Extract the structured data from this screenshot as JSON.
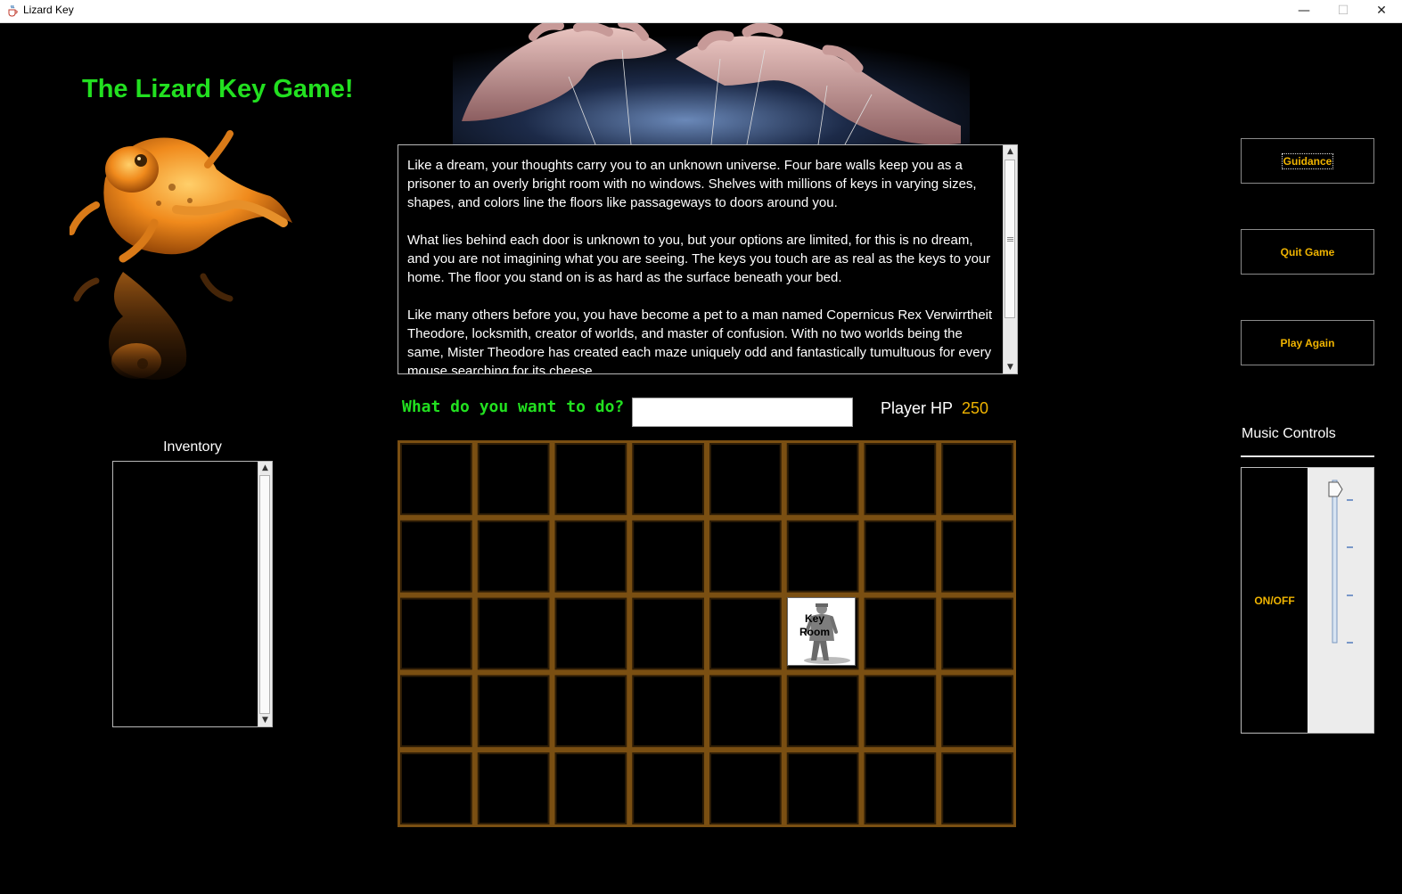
{
  "window": {
    "title": "Lizard Key",
    "minimize_glyph": "—",
    "maximize_glyph": "☐",
    "close_glyph": "✕",
    "app_icon": "java-cup-icon"
  },
  "header": {
    "game_title": "The Lizard Key Game!"
  },
  "images": {
    "left": "lizard-image",
    "top": "puppeteer-hands-image"
  },
  "story": {
    "paragraphs": [
      "Like a dream, your thoughts carry you to an unknown universe. Four bare walls keep you as a prisoner to an overly bright room with no windows. Shelves with millions of keys in varying sizes, shapes, and colors line the floors like passageways to doors around you.",
      "What lies behind each door is unknown to you, but your options are limited, for this is no dream, and you are not imagining what you are seeing. The keys you touch are as real as the keys to your home. The floor you stand on is as hard as the surface beneath your bed.",
      "Like many others before you, you have become a pet to a man named Copernicus Rex Verwirrtheit Theodore, locksmith, creator of worlds, and master of confusion. With no two worlds being the same, Mister Theodore has created each maze uniquely odd and fantastically tumultuous for every mouse searching for its cheese."
    ],
    "scroll_position": 0.25
  },
  "command": {
    "prompt": "What do you want to do?",
    "value": ""
  },
  "player": {
    "hp_label": "Player HP",
    "hp_value": "250"
  },
  "map": {
    "rows": 5,
    "cols": 8,
    "player_room": {
      "row": 2,
      "col": 5,
      "label_line1": "Key",
      "label_line2": "Room"
    },
    "floor_color": "#7a4f12",
    "room_color": "#000000"
  },
  "inventory": {
    "label": "Inventory",
    "items": []
  },
  "buttons": {
    "guidance": "Guidance",
    "quit": "Quit Game",
    "play_again": "Play Again"
  },
  "music": {
    "label": "Music Controls",
    "toggle": "ON/OFF",
    "volume": 1.0
  },
  "colors": {
    "title_green": "#22e020",
    "accent_gold": "#f0b400",
    "background": "#000000"
  }
}
